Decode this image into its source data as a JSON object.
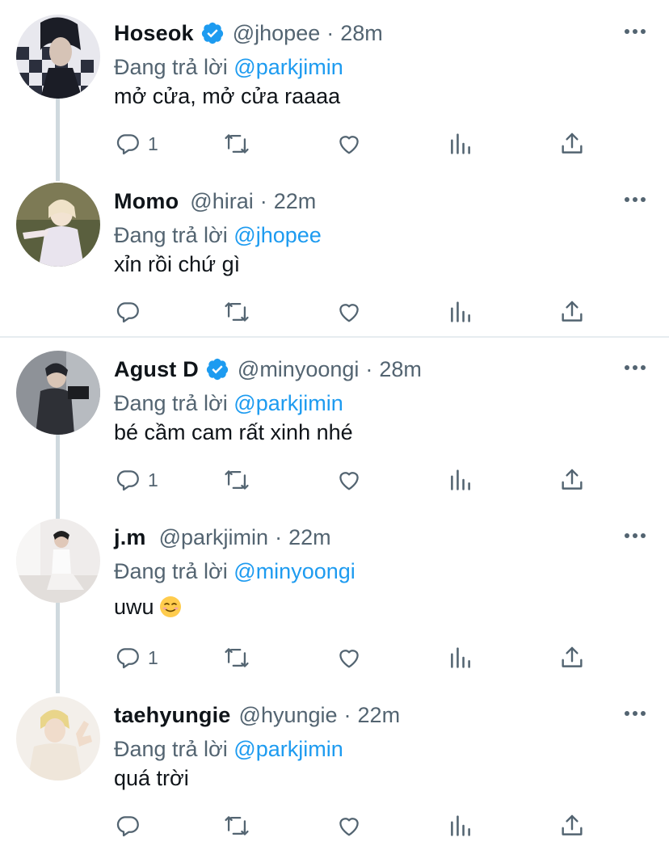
{
  "reply_prefix": "Đang trả lời",
  "tweets": [
    {
      "name": "Hoseok",
      "verified": true,
      "handle": "@jhopee",
      "separator": "·",
      "time": "28m",
      "reply_to": "@parkjimin",
      "text": "mở cửa, mở cửa raaaa",
      "reply_count": "1"
    },
    {
      "name": "Momo",
      "verified": false,
      "handle": "@hirai",
      "separator": "·",
      "time": "22m",
      "reply_to": "@jhopee",
      "text": "xỉn rồi chứ gì",
      "reply_count": ""
    },
    {
      "name": "Agust D",
      "verified": true,
      "handle": "@minyoongi",
      "separator": "·",
      "time": "28m",
      "reply_to": "@parkjimin",
      "text": "bé cầm cam rất xinh nhé",
      "reply_count": "1"
    },
    {
      "name": "j.m",
      "verified": false,
      "handle": "@parkjimin",
      "separator": "·",
      "time": "22m",
      "reply_to": "@minyoongi",
      "text": "uwu",
      "emoji": "smiling-face-emoji",
      "reply_count": "1"
    },
    {
      "name": "taehyungie",
      "verified": false,
      "handle": "@hyungie",
      "separator": "·",
      "time": "22m",
      "reply_to": "@parkjimin",
      "text": "quá trời",
      "reply_count": ""
    }
  ],
  "colors": {
    "accent": "#1d9bf0",
    "secondary_text": "#536471",
    "thread_line": "#cfd9de"
  },
  "icons": {
    "reply": "reply-icon",
    "retweet": "retweet-icon",
    "like": "heart-icon",
    "views": "views-icon",
    "share": "share-icon",
    "more": "more-icon",
    "verified": "verified-badge-icon"
  }
}
